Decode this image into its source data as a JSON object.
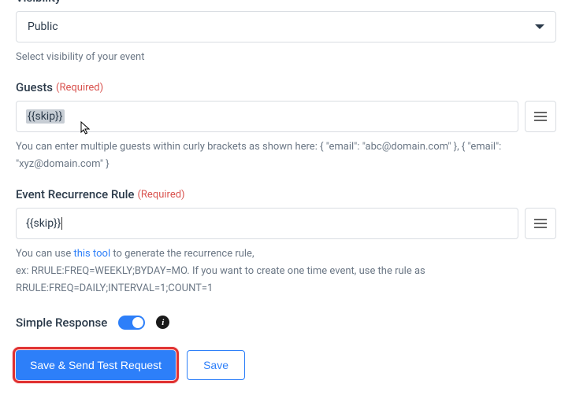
{
  "visibility": {
    "label": "Visibility",
    "value": "Public",
    "helper": "Select visibility of your event"
  },
  "guests": {
    "label": "Guests",
    "required": "(Required)",
    "value": "{{skip}}",
    "helper": "You can enter multiple guests within curly brackets as shown here: { \"email\": \"abc@domain.com\" }, { \"email\": \"xyz@domain.com\" }"
  },
  "recurrence": {
    "label": "Event Recurrence Rule",
    "required": "(Required)",
    "value": "{{skip}}",
    "helper_pre": "You can use ",
    "helper_link": "this tool",
    "helper_post": " to generate the recurrence rule,",
    "helper_line2": "ex: RRULE:FREQ=WEEKLY;BYDAY=MO. If you want to create one time event, use the rule as RRULE:FREQ=DAILY;INTERVAL=1;COUNT=1"
  },
  "simple_response": {
    "label": "Simple Response"
  },
  "buttons": {
    "save_send": "Save & Send Test Request",
    "save": "Save"
  }
}
